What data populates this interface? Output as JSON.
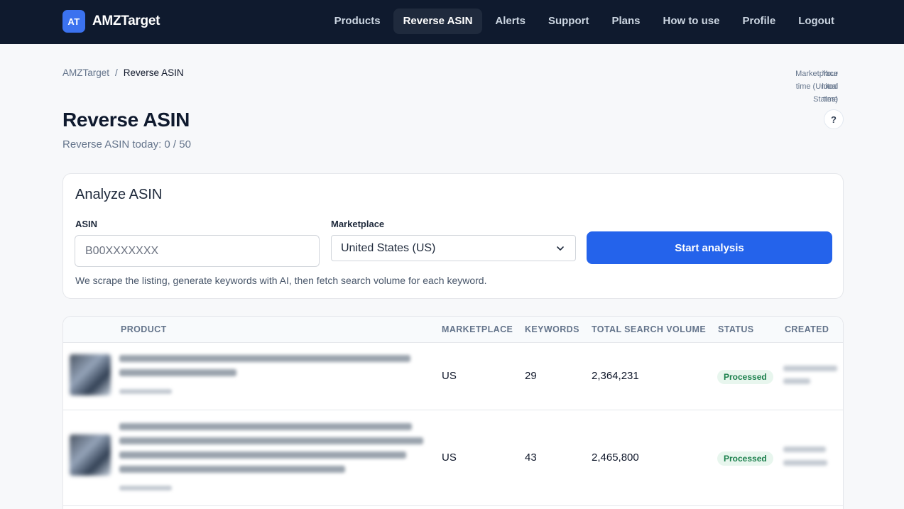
{
  "brand": {
    "badge": "AT",
    "name": "AMZTarget"
  },
  "nav": [
    {
      "label": "Products",
      "active": false
    },
    {
      "label": "Reverse ASIN",
      "active": true
    },
    {
      "label": "Alerts",
      "active": false
    },
    {
      "label": "Support",
      "active": false
    },
    {
      "label": "Plans",
      "active": false
    },
    {
      "label": "How to use",
      "active": false
    },
    {
      "label": "Profile",
      "active": false
    },
    {
      "label": "Logout",
      "active": false
    }
  ],
  "breadcrumb": {
    "root": "AMZTarget",
    "separator": "/",
    "current": "Reverse ASIN"
  },
  "times": {
    "marketplace_label": "Marketplace time (United States)",
    "local_label": "Your local time"
  },
  "page": {
    "title": "Reverse ASIN",
    "subtitle": "Reverse ASIN today: 0 / 50",
    "help": "?"
  },
  "analyze": {
    "title": "Analyze ASIN",
    "asin_label": "ASIN",
    "asin_placeholder": "B00XXXXXXX",
    "marketplace_label": "Marketplace",
    "marketplace_value": "United States (US)",
    "button": "Start analysis",
    "note": "We scrape the listing, generate keywords with AI, then fetch search volume for each keyword."
  },
  "table": {
    "headers": {
      "product": "PRODUCT",
      "marketplace": "MARKETPLACE",
      "keywords": "KEYWORDS",
      "volume": "TOTAL SEARCH VOLUME",
      "status": "STATUS",
      "created": "CREATED"
    },
    "rows": [
      {
        "marketplace": "US",
        "keywords": "29",
        "volume": "2,364,231",
        "status": "Processed"
      },
      {
        "marketplace": "US",
        "keywords": "43",
        "volume": "2,465,800",
        "status": "Processed"
      }
    ]
  },
  "colors": {
    "nav_bg": "#0f1a2e",
    "accent": "#2463eb",
    "badge_bg": "#e8f6ee",
    "badge_text": "#1a7f4b"
  }
}
